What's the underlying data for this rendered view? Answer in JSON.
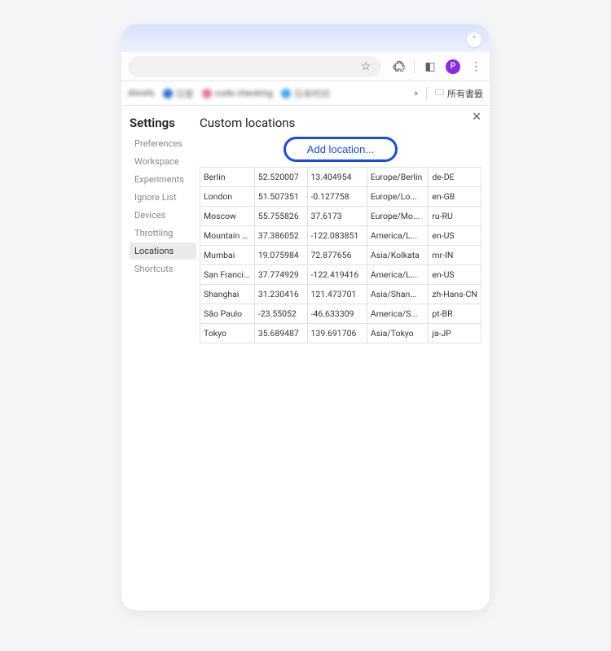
{
  "chrome": {
    "avatar_letter": "P",
    "dropdown_chevron": "ˇ",
    "star_icon": "☆",
    "extensions_icon": "⧩",
    "panel_icon": "◧",
    "more_icon": "⋮",
    "overflow_icon": "»"
  },
  "bookmarks": {
    "folder_icon": "🗀",
    "all_bookmarks": "所有書籤",
    "blurred": [
      {
        "label": "Ahrefs",
        "color": "#777"
      },
      {
        "label": "日度",
        "color": "#3571d3"
      },
      {
        "label": "code checking",
        "color": "#e57a9a"
      },
      {
        "label": "日本时间",
        "color": "#3fa9f5"
      }
    ]
  },
  "panel": {
    "close_icon": "✕",
    "settings_title": "Settings",
    "main_title": "Custom locations",
    "add_button": "Add location..."
  },
  "sidebar": {
    "items": [
      {
        "label": "Preferences"
      },
      {
        "label": "Workspace"
      },
      {
        "label": "Experiments"
      },
      {
        "label": "Ignore List"
      },
      {
        "label": "Devices"
      },
      {
        "label": "Throttling"
      },
      {
        "label": "Locations",
        "active": true
      },
      {
        "label": "Shortcuts"
      }
    ]
  },
  "locations": [
    {
      "name": "Berlin",
      "lat": "52.520007",
      "lon": "13.404954",
      "tz": "Europe/Berlin",
      "locale": "de-DE"
    },
    {
      "name": "London",
      "lat": "51.507351",
      "lon": "-0.127758",
      "tz": "Europe/Lo...",
      "locale": "en-GB"
    },
    {
      "name": "Moscow",
      "lat": "55.755826",
      "lon": "37.6173",
      "tz": "Europe/Mo...",
      "locale": "ru-RU"
    },
    {
      "name": "Mountain V...",
      "lat": "37.386052",
      "lon": "-122.083851",
      "tz": "America/L...",
      "locale": "en-US"
    },
    {
      "name": "Mumbai",
      "lat": "19.075984",
      "lon": "72.877656",
      "tz": "Asia/Kolkata",
      "locale": "mr-IN"
    },
    {
      "name": "San Franci...",
      "lat": "37.774929",
      "lon": "-122.419416",
      "tz": "America/L...",
      "locale": "en-US"
    },
    {
      "name": "Shanghai",
      "lat": "31.230416",
      "lon": "121.473701",
      "tz": "Asia/Shan...",
      "locale": "zh-Hans-CN"
    },
    {
      "name": "São Paulo",
      "lat": "-23.55052",
      "lon": "-46.633309",
      "tz": "America/S...",
      "locale": "pt-BR"
    },
    {
      "name": "Tokyo",
      "lat": "35.689487",
      "lon": "139.691706",
      "tz": "Asia/Tokyo",
      "locale": "ja-JP"
    }
  ]
}
